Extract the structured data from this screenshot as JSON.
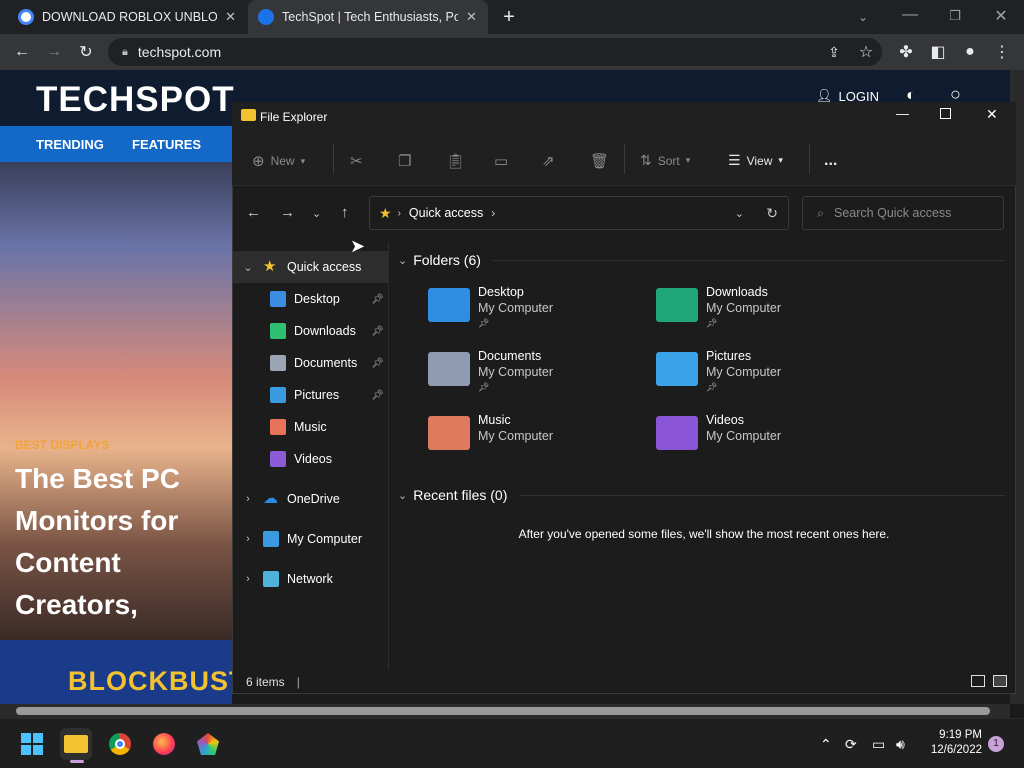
{
  "browser": {
    "tabs": [
      {
        "label": "DOWNLOAD ROBLOX UNBLOCKED",
        "active": false,
        "favicon_color": "#4285f4"
      },
      {
        "label": "TechSpot | Tech Enthusiasts, Power Users",
        "active": true,
        "favicon_color": "#1a73e8"
      }
    ],
    "new_tab_icon": "plus-icon",
    "url": "techspot.com"
  },
  "site": {
    "logo": "TECHSPOT",
    "login": "LOGIN",
    "nav": [
      "TRENDING",
      "FEATURES"
    ],
    "hero_tag": "BEST DISPLAYS",
    "hero_title": "The Best PC Monitors for\nContent Creators,\nGamers, Office &\nEnthusiasts",
    "banner": "BLOCKBUSTER"
  },
  "explorer": {
    "title": "File Explorer",
    "toolbar": {
      "new": "New",
      "sort": "Sort",
      "view": "View",
      "more": "..."
    },
    "address": {
      "location": "Quick access"
    },
    "search_placeholder": "Search Quick access",
    "nav": {
      "quick_access": "Quick access",
      "pinned": [
        {
          "label": "Desktop",
          "pinned": true,
          "color": "#3a8de0"
        },
        {
          "label": "Downloads",
          "pinned": true,
          "color": "#2fbf71"
        },
        {
          "label": "Documents",
          "pinned": true,
          "color": "#9aa4b2"
        },
        {
          "label": "Pictures",
          "pinned": true,
          "color": "#3a9be0"
        },
        {
          "label": "Music",
          "pinned": false,
          "color": "#e8735a"
        },
        {
          "label": "Videos",
          "pinned": false,
          "color": "#8b5cd6"
        }
      ],
      "roots": [
        "OneDrive",
        "My Computer",
        "Network"
      ]
    },
    "folders_header": "Folders (6)",
    "folders": [
      {
        "name": "Desktop",
        "location": "My Computer",
        "pinned": true,
        "color": "#2f8de4"
      },
      {
        "name": "Downloads",
        "location": "My Computer",
        "pinned": true,
        "color": "#21a67a"
      },
      {
        "name": "Documents",
        "location": "My Computer",
        "pinned": true,
        "color": "#8f9bb0"
      },
      {
        "name": "Pictures",
        "location": "My Computer",
        "pinned": true,
        "color": "#3aa3e8"
      },
      {
        "name": "Music",
        "location": "My Computer",
        "pinned": false,
        "color": "#e07a5f"
      },
      {
        "name": "Videos",
        "location": "My Computer",
        "pinned": false,
        "color": "#8a55d6"
      }
    ],
    "recent_header": "Recent files (0)",
    "recent_empty": "After you've opened some files, we'll show the most recent ones here.",
    "status": "6 items"
  },
  "taskbar": {
    "time": "9:19 PM",
    "date": "12/6/2022",
    "notification_count": "1"
  }
}
